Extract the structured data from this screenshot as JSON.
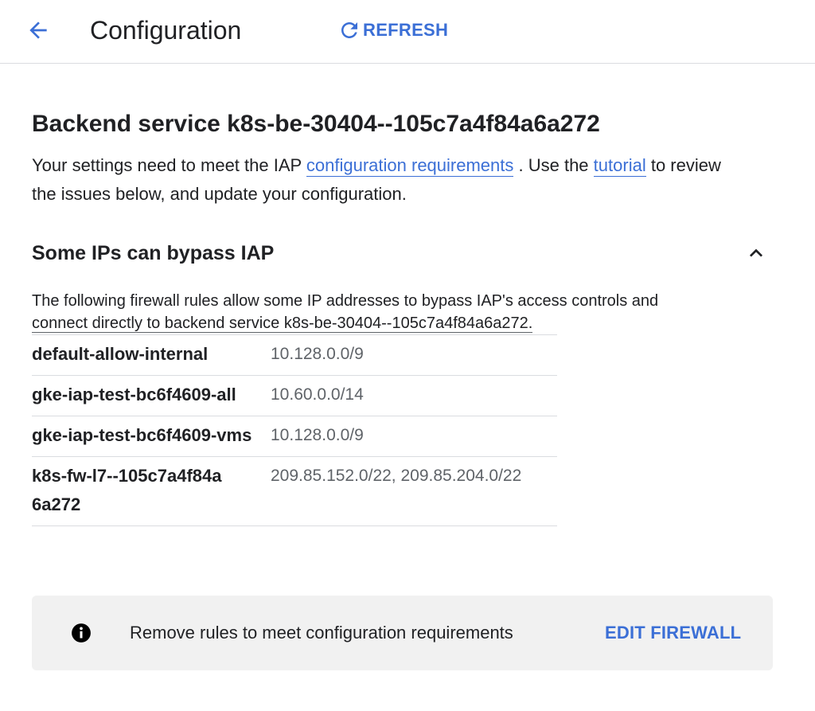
{
  "header": {
    "title": "Configuration",
    "refresh_label": "REFRESH"
  },
  "service": {
    "title": "Backend service k8s-be-30404--105c7a4f84a6a272",
    "intro_before": "Your settings need to meet the IAP ",
    "link_requirements": "configuration requirements",
    "intro_middle": " . Use the ",
    "link_tutorial": "tutorial",
    "intro_after": " to review the issues below, and update your configuration."
  },
  "section": {
    "title": "Some IPs can bypass IAP",
    "description_line1": "The following firewall rules allow some IP addresses to bypass IAP's access controls and",
    "description_line2": "connect directly to backend service k8s-be-30404--105c7a4f84a6a272."
  },
  "rules": [
    {
      "name": "default-allow-internal",
      "ips": "10.128.0.0/9"
    },
    {
      "name": "gke-iap-test-bc6f4609-all",
      "ips": "10.60.0.0/14"
    },
    {
      "name": "gke-iap-test-bc6f4609-vms",
      "ips": "10.128.0.0/9"
    },
    {
      "name": "k8s-fw-l7--105c7a4f84a6a272",
      "ips": "209.85.152.0/22, 209.85.204.0/22"
    }
  ],
  "notice": {
    "icon": "info-icon",
    "text": "Remove rules to meet configuration requirements",
    "action_label": "EDIT FIREWALL"
  },
  "colors": {
    "accent": "#3b6fd6",
    "notice_bg": "#f1f1f1",
    "muted_text": "#5f6368"
  }
}
